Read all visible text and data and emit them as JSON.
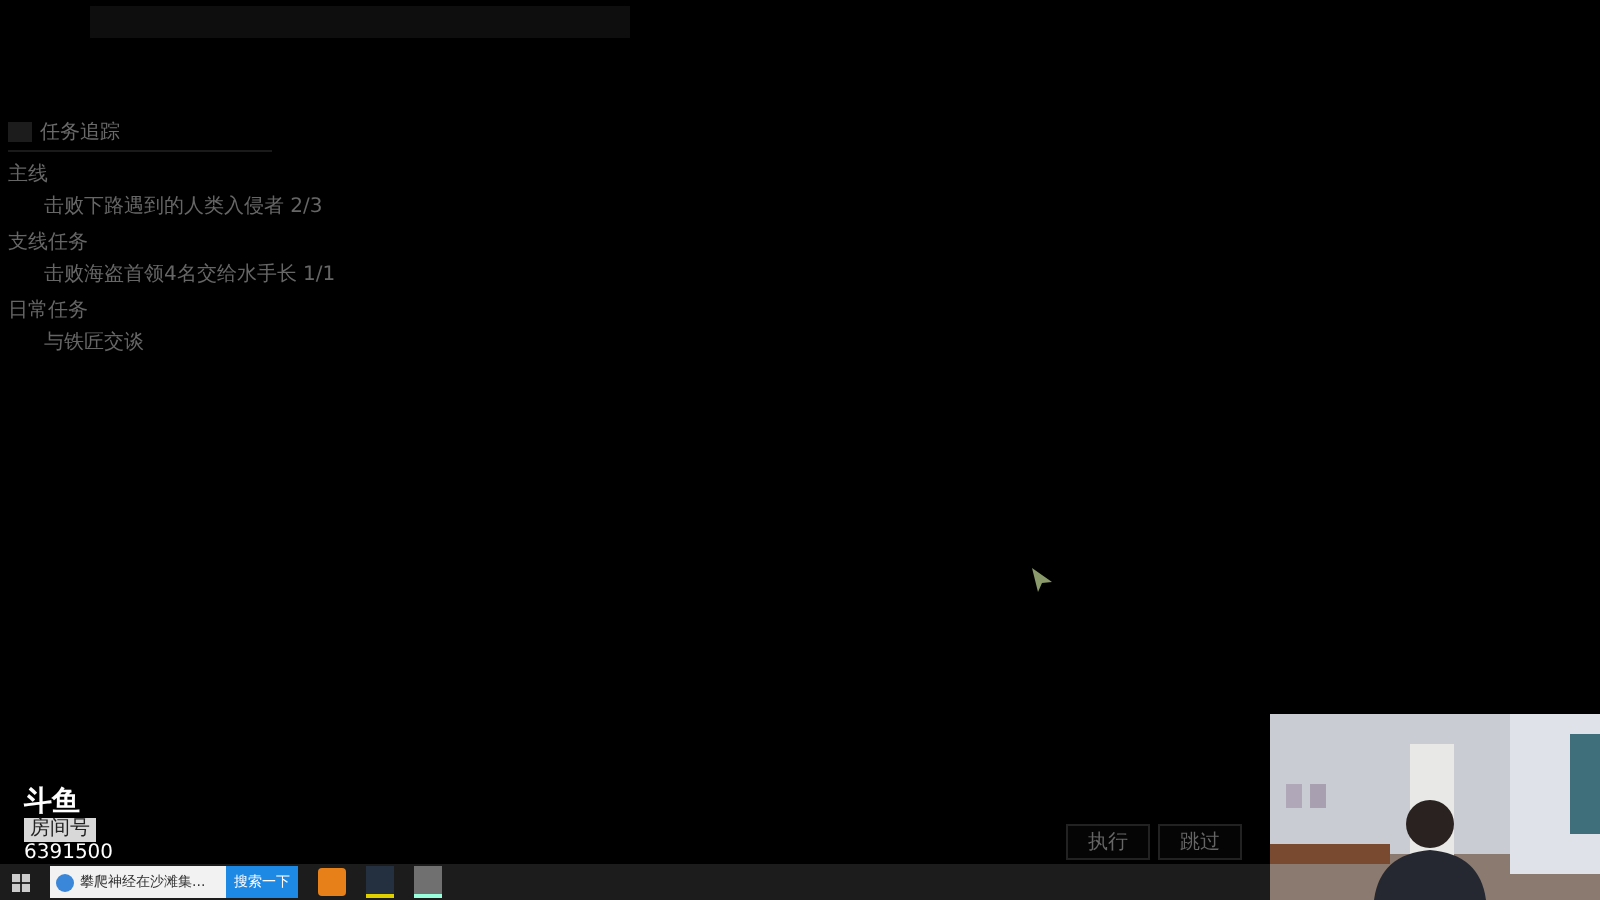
{
  "tracker": {
    "title": "任务追踪",
    "sections": [
      {
        "heading": "主线",
        "tasks": [
          "击败下路遇到的人类入侵者 2/3"
        ]
      },
      {
        "heading": "支线任务",
        "tasks": [
          "击败海盗首领4名交给水手长 1/1"
        ]
      },
      {
        "heading": "日常任务",
        "tasks": [
          "与铁匠交谈"
        ]
      }
    ]
  },
  "game_buttons": [
    "执行",
    "跳过"
  ],
  "stream_overlay": {
    "logo": "斗鱼",
    "room_label": "房间号",
    "room_number": "6391500"
  },
  "taskbar": {
    "search_text": "攀爬神经在沙滩集...",
    "search_button": "搜索一下"
  },
  "webcam": {
    "kind": "picture"
  }
}
